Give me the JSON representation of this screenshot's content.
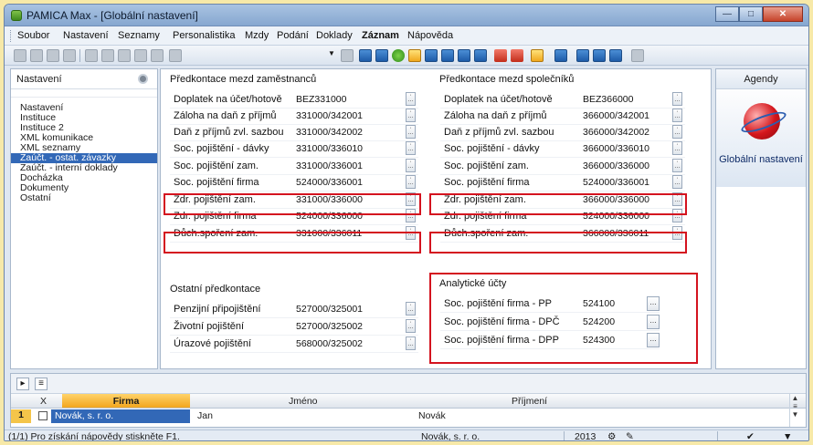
{
  "window": {
    "title": "PAMICA Max - [Globální nastavení]"
  },
  "menu": [
    "Soubor",
    "Nastavení",
    "Seznamy",
    "Personalistika",
    "Mzdy",
    "Podání",
    "Doklady",
    "Záznam",
    "Nápověda"
  ],
  "menu_bold": "Záznam",
  "left_panel": {
    "header": "Nastavení",
    "items": [
      "Nastavení",
      "Instituce",
      "Instituce 2",
      "XML komunikace",
      "XML seznamy",
      "Zaúčt. - ostat. závazky",
      "Zaúčt. - interní doklady",
      "Docházka",
      "Dokumenty",
      "Ostatní"
    ],
    "selected": "Zaúčt. - ostat. závazky"
  },
  "employees_section": {
    "title": "Předkontace mezd zaměstnanců",
    "rows": [
      {
        "label": "Doplatek na účet/hotově",
        "value": "BEZ331000"
      },
      {
        "label": "Záloha na daň z příjmů",
        "value": "331000/342001"
      },
      {
        "label": "Daň z příjmů zvl. sazbou",
        "value": "331000/342002"
      },
      {
        "label": "Soc. pojištění - dávky",
        "value": "331000/336010"
      },
      {
        "label": "Soc. pojištění zam.",
        "value": "331000/336001"
      },
      {
        "label": "Soc. pojištění firma",
        "value": "524000/336001"
      },
      {
        "label": "Zdr. pojištění zam.",
        "value": "331000/336000"
      },
      {
        "label": "Zdr. pojištění firma",
        "value": "524000/336000"
      },
      {
        "label": "Důch.spoření zam.",
        "value": "331000/336011"
      }
    ]
  },
  "other_section": {
    "title": "Ostatní předkontace",
    "rows": [
      {
        "label": "Penzijní připojištění",
        "value": "527000/325001"
      },
      {
        "label": "Životní pojištění",
        "value": "527000/325002"
      },
      {
        "label": "Úrazové pojištění",
        "value": "568000/325002"
      }
    ]
  },
  "partners_section": {
    "title": "Předkontace mezd společníků",
    "rows": [
      {
        "label": "Doplatek na účet/hotově",
        "value": "BEZ366000"
      },
      {
        "label": "Záloha na daň z příjmů",
        "value": "366000/342001"
      },
      {
        "label": "Daň z příjmů zvl. sazbou",
        "value": "366000/342002"
      },
      {
        "label": "Soc. pojištění - dávky",
        "value": "366000/336010"
      },
      {
        "label": "Soc. pojištění zam.",
        "value": "366000/336000"
      },
      {
        "label": "Soc. pojištění firma",
        "value": "524000/336001"
      },
      {
        "label": "Zdr. pojištění zam.",
        "value": "366000/336000"
      },
      {
        "label": "Zdr. pojištění firma",
        "value": "524000/336000"
      },
      {
        "label": "Důch.spoření zam.",
        "value": "366000/336011"
      }
    ]
  },
  "analytic_section": {
    "title": "Analytické účty",
    "rows": [
      {
        "label": "Soc. pojištění firma - PP",
        "value": "524100"
      },
      {
        "label": "Soc. pojištění firma - DPČ",
        "value": "524200"
      },
      {
        "label": "Soc. pojištění firma - DPP",
        "value": "524300"
      }
    ]
  },
  "agendy": {
    "header": "Agendy",
    "label": "Globální nastavení"
  },
  "grid": {
    "columns": {
      "x": "X",
      "firma": "Firma",
      "jmeno": "Jméno",
      "prijmeni": "Příjmení"
    },
    "row": {
      "num": "1",
      "firma": "Novák, s. r. o.",
      "jmeno": "Jan",
      "prijmeni": "Novák"
    }
  },
  "status": {
    "help": "(1/1) Pro získání nápovědy stiskněte F1.",
    "firm": "Novák, s. r. o.",
    "year": "2013"
  },
  "colors": {
    "highlight": "#d4131f",
    "selection": "#3268b7",
    "grid_accent": "#f2a51d"
  }
}
